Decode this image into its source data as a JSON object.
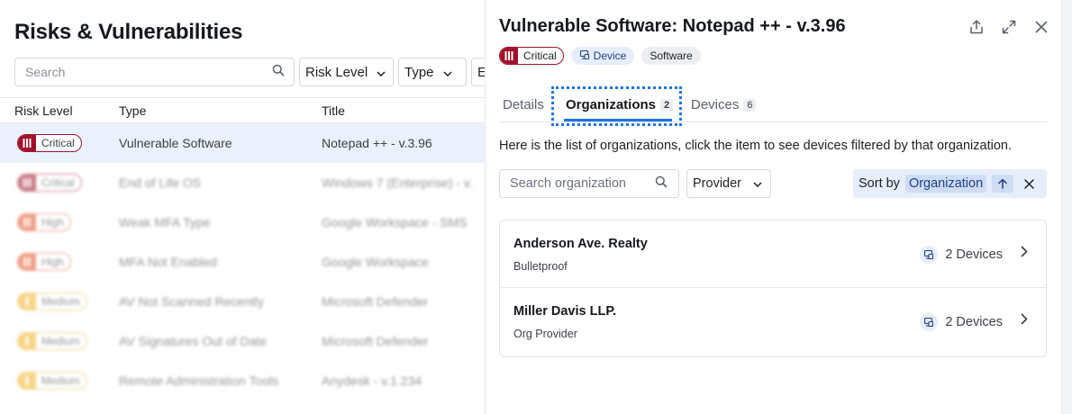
{
  "left": {
    "page_title": "Risks & Vulnerabilities",
    "search_placeholder": "Search",
    "filters": {
      "risk_level": "Risk Level",
      "type": "Type",
      "env": "En"
    },
    "columns": {
      "risk_level": "Risk Level",
      "type": "Type",
      "title": "Title"
    },
    "rows": [
      {
        "risk": "Critical",
        "type": "Vulnerable Software",
        "title": "Notepad ++ - v.3.96"
      },
      {
        "risk": "Critical",
        "type": "End of Life OS",
        "title": "Windows 7 (Enterprise) - v."
      },
      {
        "risk": "High",
        "type": "Weak MFA Type",
        "title": "Google Workspace - SMS"
      },
      {
        "risk": "High",
        "type": "MFA Not Enabled",
        "title": "Google Workspace"
      },
      {
        "risk": "Medium",
        "type": "AV Not Scanned Recently",
        "title": "Microsoft Defender"
      },
      {
        "risk": "Medium",
        "type": "AV Signatures Out of Date",
        "title": "Microsoft Defender"
      },
      {
        "risk": "Medium",
        "type": "Remote Administration Tools",
        "title": "Anydesk - v.1.234"
      }
    ]
  },
  "detail": {
    "title": "Vulnerable Software: Notepad ++ - v.3.96",
    "tags": {
      "risk": "Critical",
      "device": "Device",
      "software": "Software"
    },
    "tabs": [
      {
        "label": "Details",
        "count": ""
      },
      {
        "label": "Organizations",
        "count": "2"
      },
      {
        "label": "Devices",
        "count": "6"
      }
    ],
    "description": "Here is the list of organizations, click the item to see devices filtered by that organization.",
    "org_search_placeholder": "Search organization",
    "provider_label": "Provider",
    "sort": {
      "label": "Sort by",
      "value": "Organization"
    },
    "organizations": [
      {
        "name": "Anderson Ave. Realty",
        "provider": "Bulletproof",
        "devices": "2 Devices"
      },
      {
        "name": "Miller Davis LLP.",
        "provider": "Org Provider",
        "devices": "2 Devices"
      }
    ]
  },
  "colors": {
    "critical": "#a0122b",
    "high": "#e5532a",
    "medium": "#f0b429",
    "accent": "#1a73e8",
    "selected_row": "#eaf1fd"
  },
  "icons": [
    "search-icon",
    "chevron-down-icon",
    "share-icon",
    "expand-icon",
    "close-icon",
    "device-icon",
    "arrow-up-icon",
    "chevron-right-icon"
  ]
}
